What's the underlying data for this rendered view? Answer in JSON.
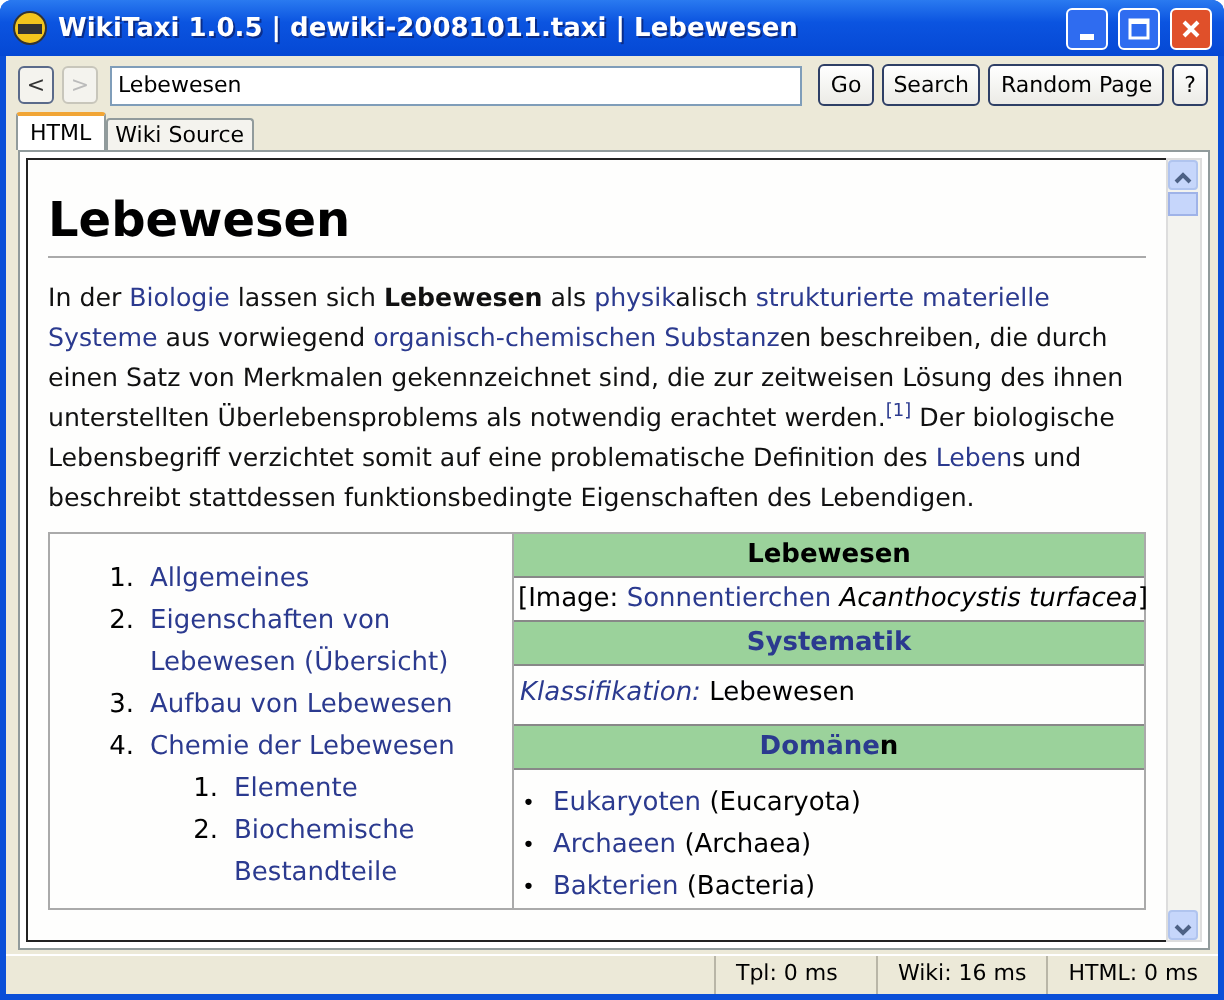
{
  "window": {
    "title": "WikiTaxi 1.0.5 | dewiki-20081011.taxi | Lebewesen"
  },
  "toolbar": {
    "back": "<",
    "forward": ">",
    "forward_disabled": true,
    "address": "Lebewesen",
    "buttons": [
      "Go",
      "Search",
      "Random Page",
      "?"
    ]
  },
  "tabs": [
    {
      "label": "HTML",
      "selected": true
    },
    {
      "label": "Wiki Source",
      "selected": false
    }
  ],
  "article": {
    "heading": "Lebewesen",
    "paragraph": [
      {
        "kind": "text",
        "text": "In der "
      },
      {
        "kind": "link",
        "text": "Biologie"
      },
      {
        "kind": "text",
        "text": " lassen sich "
      },
      {
        "kind": "bold",
        "text": "Lebewesen"
      },
      {
        "kind": "text",
        "text": " als "
      },
      {
        "kind": "link",
        "text": "physik"
      },
      {
        "kind": "text",
        "text": "alisch "
      },
      {
        "kind": "link",
        "text": "strukturierte"
      },
      {
        "kind": "space"
      },
      {
        "kind": "link",
        "text": "materielle"
      },
      {
        "kind": "space"
      },
      {
        "kind": "link",
        "text": "Systeme"
      },
      {
        "kind": "text",
        "text": " aus vorwiegend "
      },
      {
        "kind": "link",
        "text": "organisch-chemischen"
      },
      {
        "kind": "space"
      },
      {
        "kind": "link",
        "text": "Substanz"
      },
      {
        "kind": "text",
        "text": "en beschreiben, die durch einen Satz von Merkmalen gekennzeichnet sind, die zur zeitweisen Lösung des ihnen unterstellten Überlebensproblems als notwendig erachtet werden."
      },
      {
        "kind": "ref",
        "text": "[1]"
      },
      {
        "kind": "text",
        "text": " Der biologische Lebensbegriff verzichtet somit auf eine problematische Definition des "
      },
      {
        "kind": "link",
        "text": "Leben"
      },
      {
        "kind": "text",
        "text": "s und beschreibt stattdessen funktionsbedingte Eigenschaften des Lebendigen."
      }
    ],
    "toc": [
      {
        "number": "1.",
        "label": "Allgemeines"
      },
      {
        "number": "2.",
        "label": "Eigenschaften von Lebewesen (Übersicht)"
      },
      {
        "number": "3.",
        "label": "Aufbau von Lebewesen"
      },
      {
        "number": "4.",
        "label": "Chemie der Lebewesen",
        "children": [
          {
            "number": "1.",
            "label": "Elemente"
          },
          {
            "number": "2.",
            "label": "Biochemische Bestandteile"
          }
        ]
      }
    ],
    "infobox": [
      {
        "kind": "title",
        "text": "Lebewesen"
      },
      {
        "kind": "image",
        "prefix": "[Image: ",
        "link": "Sonnentierchen",
        "italic": "Acanthocystis turfacea",
        "suffix": "]"
      },
      {
        "kind": "section",
        "link": "Systematik"
      },
      {
        "kind": "field",
        "label": "Klassifikation:",
        "value": "Lebewesen"
      },
      {
        "kind": "section",
        "link": "Domäne",
        "rest": "n"
      },
      {
        "kind": "list",
        "items": [
          {
            "bullet": "•",
            "link": "Eukaryoten",
            "rest": "(Eucaryota)"
          },
          {
            "bullet": "•",
            "link": "Archaeen",
            "rest": "(Archaea)"
          },
          {
            "bullet": "•",
            "link": "Bakterien",
            "rest": "(Bacteria)"
          }
        ]
      }
    ]
  },
  "status_bar": [
    "Tpl: 0 ms",
    "Wiki: 16 ms",
    "HTML: 0 ms"
  ]
}
